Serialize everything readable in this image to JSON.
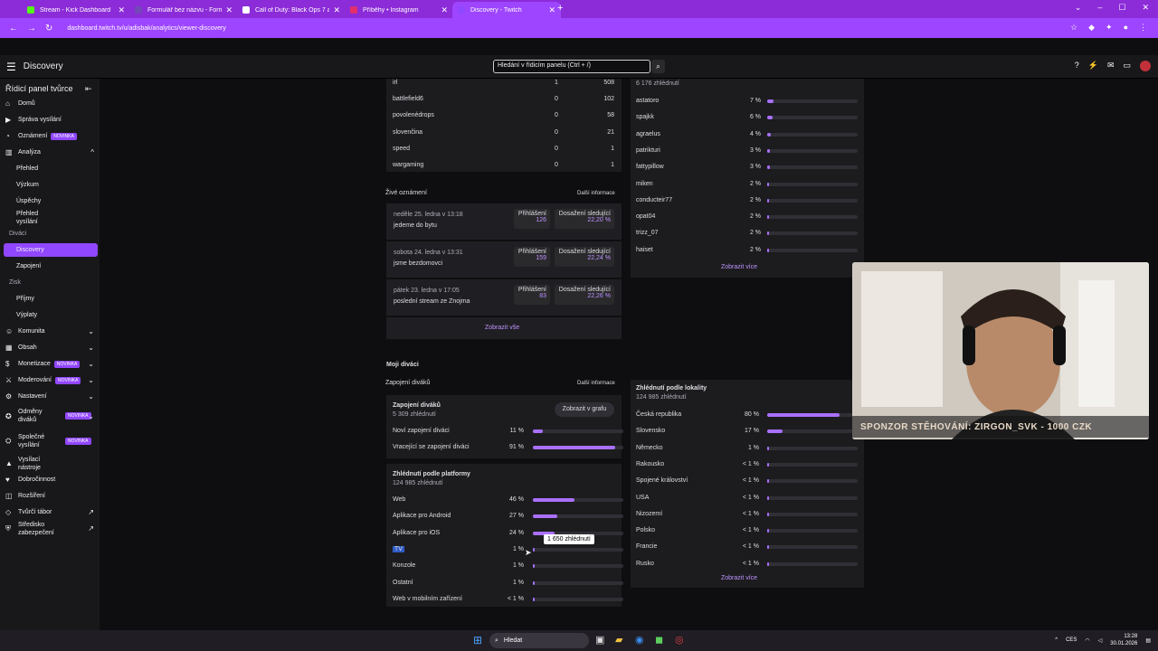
{
  "browser": {
    "tabs": [
      {
        "title": "Stream - Kick Dashboard",
        "color": "#53fc18"
      },
      {
        "title": "Formulář bez názvu - Formuláře",
        "color": "#7248b9"
      },
      {
        "title": "Call of Duty: Black Ops 7 and C",
        "color": "#fff"
      },
      {
        "title": "Příběhy • Instagram",
        "color": "#e1306c"
      },
      {
        "title": "Discovery - Twitch",
        "color": "#9147ff"
      }
    ],
    "url": "dashboard.twitch.tv/u/adisbak/analytics/viewer-discovery"
  },
  "header": {
    "title": "Discovery",
    "search_placeholder": "Hledání v řídicím panelu (Ctrl + /)"
  },
  "sidebar": {
    "title": "Řídicí panel tvůrce",
    "items": [
      {
        "label": "Domů"
      },
      {
        "label": "Správa vysílání"
      },
      {
        "label": "Oznámení",
        "badge": "NOVINKA"
      },
      {
        "label": "Analýza"
      },
      {
        "label": "Přehled"
      },
      {
        "label": "Výzkum"
      },
      {
        "label": "Úspěchy"
      },
      {
        "label": "Přehled vysílání"
      },
      {
        "label": "Diváci"
      },
      {
        "label": "Discovery"
      },
      {
        "label": "Zapojení"
      },
      {
        "label": "Zisk"
      },
      {
        "label": "Příjmy"
      },
      {
        "label": "Výplaty"
      },
      {
        "label": "Komunita"
      },
      {
        "label": "Obsah"
      },
      {
        "label": "Monetizace",
        "badge": "NOVINKA"
      },
      {
        "label": "Moderování",
        "badge": "NOVINKA"
      },
      {
        "label": "Nastavení"
      },
      {
        "label": "Odměny diváků",
        "badge": "NOVINKA"
      },
      {
        "label": "Společné vysílání",
        "badge": "NOVINKA"
      },
      {
        "label": "Vysílací nástroje"
      },
      {
        "label": "Dobročinnost"
      },
      {
        "label": "Rozšíření"
      },
      {
        "label": "Tvůrčí tábor"
      },
      {
        "label": "Středisko zabezpečení"
      }
    ]
  },
  "tags": [
    {
      "name": "irl",
      "a": "1",
      "b": "508"
    },
    {
      "name": "battlefield6",
      "a": "0",
      "b": "102"
    },
    {
      "name": "povolenédrops",
      "a": "0",
      "b": "58"
    },
    {
      "name": "slovenčina",
      "a": "0",
      "b": "21"
    },
    {
      "name": "speed",
      "a": "0",
      "b": "1"
    },
    {
      "name": "wargaming",
      "a": "0",
      "b": "1"
    }
  ],
  "live": {
    "title": "Živé oznámení",
    "more": "Další informace",
    "show_all": "Zobrazit vše",
    "login_label": "Přihlášení",
    "reach_label": "Dosažení sledující",
    "items": [
      {
        "date": "neděle 25. ledna v 13:18",
        "text": "jedeme do bytu",
        "login": "126",
        "reach": "22,20 %"
      },
      {
        "date": "sobota 24. ledna v 13:31",
        "text": "jsme bezdomovci",
        "login": "159",
        "reach": "22,24 %"
      },
      {
        "date": "pátek 23. ledna v 17:05",
        "text": "poslední stream ze Znojma",
        "login": "83",
        "reach": "22,26 %"
      }
    ]
  },
  "my_viewers": {
    "title": "Moji diváci",
    "engagement": "Zapojení diváků",
    "more": "Další informace",
    "card_title": "Zapojení diváků",
    "card_sub": "5 309 zhlédnutí",
    "chart_btn": "Zobrazit v grafu",
    "rows": [
      {
        "label": "Noví zapojení diváci",
        "pct": "11 %",
        "v": 0.11
      },
      {
        "label": "Vracející se zapojení diváci",
        "pct": "91 %",
        "v": 0.91
      }
    ]
  },
  "platforms": {
    "title": "Zhlédnutí podle platformy",
    "sub": "124 985 zhlédnutí",
    "rows": [
      {
        "label": "Web",
        "pct": "46 %",
        "v": 0.46
      },
      {
        "label": "Aplikace pro Android",
        "pct": "27 %",
        "v": 0.27
      },
      {
        "label": "Aplikace pro iOS",
        "pct": "24 %",
        "v": 0.24
      },
      {
        "label": "TV",
        "pct": "1 %",
        "v": 0.01
      },
      {
        "label": "Konzole",
        "pct": "1 %",
        "v": 0.01
      },
      {
        "label": "Ostatní",
        "pct": "1 %",
        "v": 0.01
      },
      {
        "label": "Web v mobilním zařízení",
        "pct": "< 1 %",
        "v": 0.005
      }
    ],
    "tooltip": "1 650 zhlédnutí"
  },
  "channels": {
    "sub": "6 176 zhlédnutí",
    "more": "Zobrazit více",
    "rows": [
      {
        "label": "astatoro",
        "pct": "7 %",
        "v": 0.07
      },
      {
        "label": "spajkk",
        "pct": "6 %",
        "v": 0.06
      },
      {
        "label": "agraelus",
        "pct": "4 %",
        "v": 0.04
      },
      {
        "label": "patrikturi",
        "pct": "3 %",
        "v": 0.03
      },
      {
        "label": "fattypillow",
        "pct": "3 %",
        "v": 0.03
      },
      {
        "label": "miken",
        "pct": "2 %",
        "v": 0.02
      },
      {
        "label": "conducteir77",
        "pct": "2 %",
        "v": 0.02
      },
      {
        "label": "opat04",
        "pct": "2 %",
        "v": 0.02
      },
      {
        "label": "trizz_07",
        "pct": "2 %",
        "v": 0.02
      },
      {
        "label": "haiset",
        "pct": "2 %",
        "v": 0.02
      }
    ]
  },
  "locations": {
    "title": "Zhlédnutí podle lokality",
    "sub": "124 985 zhlédnutí",
    "more": "Zobrazit více",
    "rows": [
      {
        "label": "Česká republika",
        "pct": "80 %",
        "v": 0.8
      },
      {
        "label": "Slovensko",
        "pct": "17 %",
        "v": 0.17
      },
      {
        "label": "Německo",
        "pct": "1 %",
        "v": 0.01
      },
      {
        "label": "Rakousko",
        "pct": "< 1 %",
        "v": 0.005
      },
      {
        "label": "Spojené království",
        "pct": "< 1 %",
        "v": 0.005
      },
      {
        "label": "USA",
        "pct": "< 1 %",
        "v": 0.005
      },
      {
        "label": "Nizozemí",
        "pct": "< 1 %",
        "v": 0.005
      },
      {
        "label": "Polsko",
        "pct": "< 1 %",
        "v": 0.005
      },
      {
        "label": "Francie",
        "pct": "< 1 %",
        "v": 0.005
      },
      {
        "label": "Rusko",
        "pct": "< 1 %",
        "v": 0.005
      }
    ]
  },
  "overlay": {
    "sponsor": "SPONZOR STĚHOVÁNÍ: ZIRGON_SVK - 1000 CZK"
  },
  "taskbar": {
    "search": "Hledat",
    "lang": "CES",
    "time": "13:28",
    "date": "30.01.2026"
  }
}
